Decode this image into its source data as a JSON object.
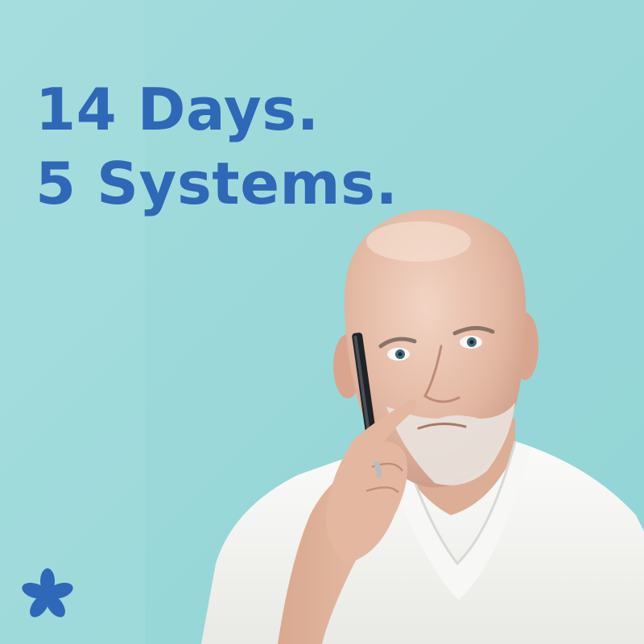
{
  "headline": {
    "line1": "14 Days.",
    "line2": "5 Systems."
  },
  "colors": {
    "background": "#9fdcdc",
    "headline": "#2f68b7",
    "logo": "#2f68b7",
    "shirt": "#f3f3f1",
    "skin": "#e6bca3"
  },
  "icons": {
    "logo": "blue-flower-asterisk-logo-icon"
  }
}
